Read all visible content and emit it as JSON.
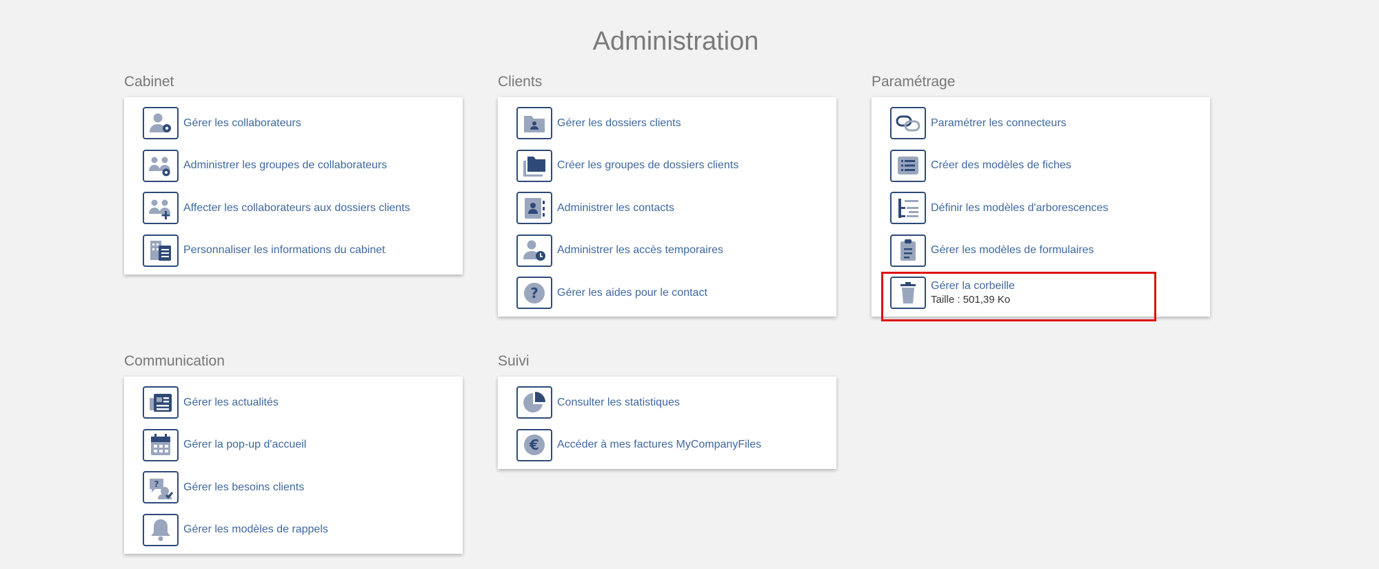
{
  "page": {
    "title": "Administration"
  },
  "sections": {
    "cabinet": {
      "title": "Cabinet",
      "items": [
        {
          "label": "Gérer les collaborateurs",
          "icon": "user-gear-icon"
        },
        {
          "label": "Administrer les groupes de collaborateurs",
          "icon": "users-gear-icon"
        },
        {
          "label": "Affecter les collaborateurs aux dossiers clients",
          "icon": "users-plus-icon"
        },
        {
          "label": "Personnaliser les informations du cabinet",
          "icon": "building-list-icon"
        }
      ]
    },
    "clients": {
      "title": "Clients",
      "items": [
        {
          "label": "Gérer les dossiers clients",
          "icon": "folder-user-icon"
        },
        {
          "label": "Créer les groupes de dossiers clients",
          "icon": "folders-icon"
        },
        {
          "label": "Administrer les contacts",
          "icon": "contact-card-icon"
        },
        {
          "label": "Administrer les accès temporaires",
          "icon": "user-clock-icon"
        },
        {
          "label": "Gérer les aides pour le contact",
          "icon": "question-icon"
        }
      ]
    },
    "parametrage": {
      "title": "Paramétrage",
      "items": [
        {
          "label": "Paramétrer les connecteurs",
          "icon": "link-icon"
        },
        {
          "label": "Créer des modèles de fiches",
          "icon": "list-card-icon"
        },
        {
          "label": "Définir les modèles d'arborescences",
          "icon": "tree-list-icon"
        },
        {
          "label": "Gérer les modèles de formulaires",
          "icon": "clipboard-icon"
        },
        {
          "label": "Gérer la corbeille",
          "icon": "trash-icon",
          "subtext": "Taille : 501,39 Ko"
        }
      ]
    },
    "communication": {
      "title": "Communication",
      "items": [
        {
          "label": "Gérer les actualités",
          "icon": "newspaper-icon"
        },
        {
          "label": "Gérer la pop-up d'accueil",
          "icon": "calendar-icon"
        },
        {
          "label": "Gérer les besoins clients",
          "icon": "chat-check-icon"
        },
        {
          "label": "Gérer les modèles de rappels",
          "icon": "bell-icon"
        }
      ]
    },
    "suivi": {
      "title": "Suivi",
      "items": [
        {
          "label": "Consulter les statistiques",
          "icon": "pie-chart-icon"
        },
        {
          "label": "Accéder à mes factures MyCompanyFiles",
          "icon": "euro-icon"
        }
      ]
    }
  },
  "colors": {
    "link": "#3f68a0",
    "icon_border": "#2f4a78",
    "icon_fill": "#9aa6bd",
    "icon_dark": "#2f4a78",
    "highlight": "#e01010"
  }
}
